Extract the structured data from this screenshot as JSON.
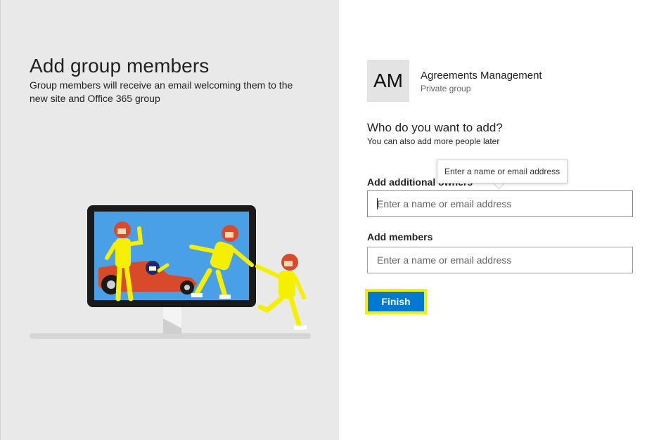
{
  "left": {
    "title": "Add group members",
    "description": "Group members will receive an email welcoming them to the new site and Office 365 group"
  },
  "group": {
    "initials": "AM",
    "name": "Agreements Management",
    "privacy": "Private group"
  },
  "prompt": {
    "question": "Who do you want to add?",
    "subtext": "You can also add more people later"
  },
  "owners": {
    "label": "Add additional owners",
    "placeholder": "Enter a name or email address",
    "value": ""
  },
  "tooltip": {
    "text": "Enter a name or email address"
  },
  "members": {
    "label": "Add members",
    "placeholder": "Enter a name or email address",
    "value": ""
  },
  "actions": {
    "finish_label": "Finish"
  },
  "colors": {
    "accent": "#0078d4",
    "highlight": "#f4f000",
    "panel": "#e9e9e9"
  }
}
